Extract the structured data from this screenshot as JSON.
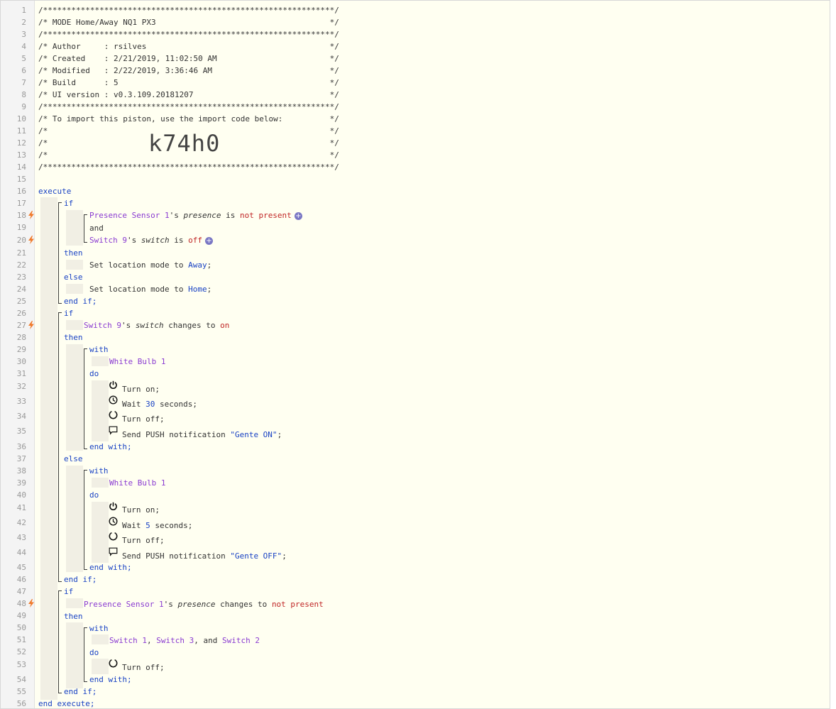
{
  "header_comment": [
    "/**************************************************************/",
    "/* MODE Home/Away NQ1 PX3                                     */",
    "/**************************************************************/",
    "/* Author     : rsilves                                       */",
    "/* Created    : 2/21/2019, 11:02:50 AM                        */",
    "/* Modified   : 2/22/2019, 3:36:46 AM                         */",
    "/* Build      : 5                                             */",
    "/* UI version : v0.3.109.20181207                             */",
    "/**************************************************************/",
    "/* To import this piston, use the import code below:          */",
    "/*                                                            */",
    "/*                                                            */",
    "/*                                                            */",
    "/**************************************************************/"
  ],
  "import_code": "k74h0",
  "keywords": {
    "execute": "execute",
    "end_execute": "end execute;",
    "if": "if",
    "then": "then",
    "else": "else",
    "end_if": "end if;",
    "and": "and",
    "with": "with",
    "do": "do",
    "end_with": "end with;"
  },
  "block1": {
    "cond1_device": "Presence Sensor 1",
    "cond1_poss": "'s ",
    "cond1_attr": "presence",
    "cond1_op": " is ",
    "cond1_val": "not present",
    "cond2_device": "Switch 9",
    "cond2_poss": "'s ",
    "cond2_attr": "switch",
    "cond2_op": " is ",
    "cond2_val": "off",
    "then_stmt_pre": "Set location mode to ",
    "then_mode": "Away",
    "else_stmt_pre": "Set location mode to ",
    "else_mode": "Home",
    "stmt_end": ";"
  },
  "block2": {
    "cond_device": "Switch 9",
    "cond_poss": "'s ",
    "cond_attr": "switch",
    "cond_op": " changes to ",
    "cond_val": "on",
    "then_device": "White Bulb 1",
    "then_turn_on": "Turn on;",
    "then_wait_pre": "Wait ",
    "then_wait_val": "30",
    "then_wait_post": " seconds;",
    "then_turn_off": "Turn off;",
    "then_push_pre": "Send PUSH notification ",
    "then_push_msg": "\"Gente ON\"",
    "then_push_end": ";",
    "else_device": "White Bulb 1",
    "else_turn_on": "Turn on;",
    "else_wait_pre": "Wait ",
    "else_wait_val": "5",
    "else_wait_post": " seconds;",
    "else_turn_off": "Turn off;",
    "else_push_pre": "Send PUSH notification ",
    "else_push_msg": "\"Gente OFF\"",
    "else_push_end": ";"
  },
  "block3": {
    "cond_device": "Presence Sensor 1",
    "cond_poss": "'s ",
    "cond_attr": "presence",
    "cond_op": " changes to ",
    "cond_val": "not present",
    "with_dev1": "Switch 1",
    "sep1": ", ",
    "with_dev2": "Switch 3",
    "sep2": ", and ",
    "with_dev3": "Switch 2",
    "turn_off": "Turn off;"
  },
  "line_numbers": [
    "1",
    "2",
    "3",
    "4",
    "5",
    "6",
    "7",
    "8",
    "9",
    "10",
    "11",
    "12",
    "13",
    "14",
    "15",
    "16",
    "17",
    "18",
    "19",
    "20",
    "21",
    "22",
    "23",
    "24",
    "25",
    "26",
    "27",
    "28",
    "29",
    "30",
    "31",
    "32",
    "33",
    "34",
    "35",
    "36",
    "37",
    "38",
    "39",
    "40",
    "41",
    "42",
    "43",
    "44",
    "45",
    "46",
    "47",
    "48",
    "49",
    "50",
    "51",
    "52",
    "53",
    "54",
    "55",
    "56"
  ],
  "colors": {
    "keyword": "#1a43c4",
    "device": "#8a3bd1",
    "value": "#c02626",
    "trigger_bolt": "#f07a2a",
    "editor_bg": "#fffff1"
  },
  "icons": {
    "trigger": "lightning-bolt-icon",
    "power_on": "power-icon",
    "wait": "clock-icon",
    "power_off": "circle-off-icon",
    "push": "speech-bubble-icon",
    "add_condition": "plus-circle-icon"
  }
}
